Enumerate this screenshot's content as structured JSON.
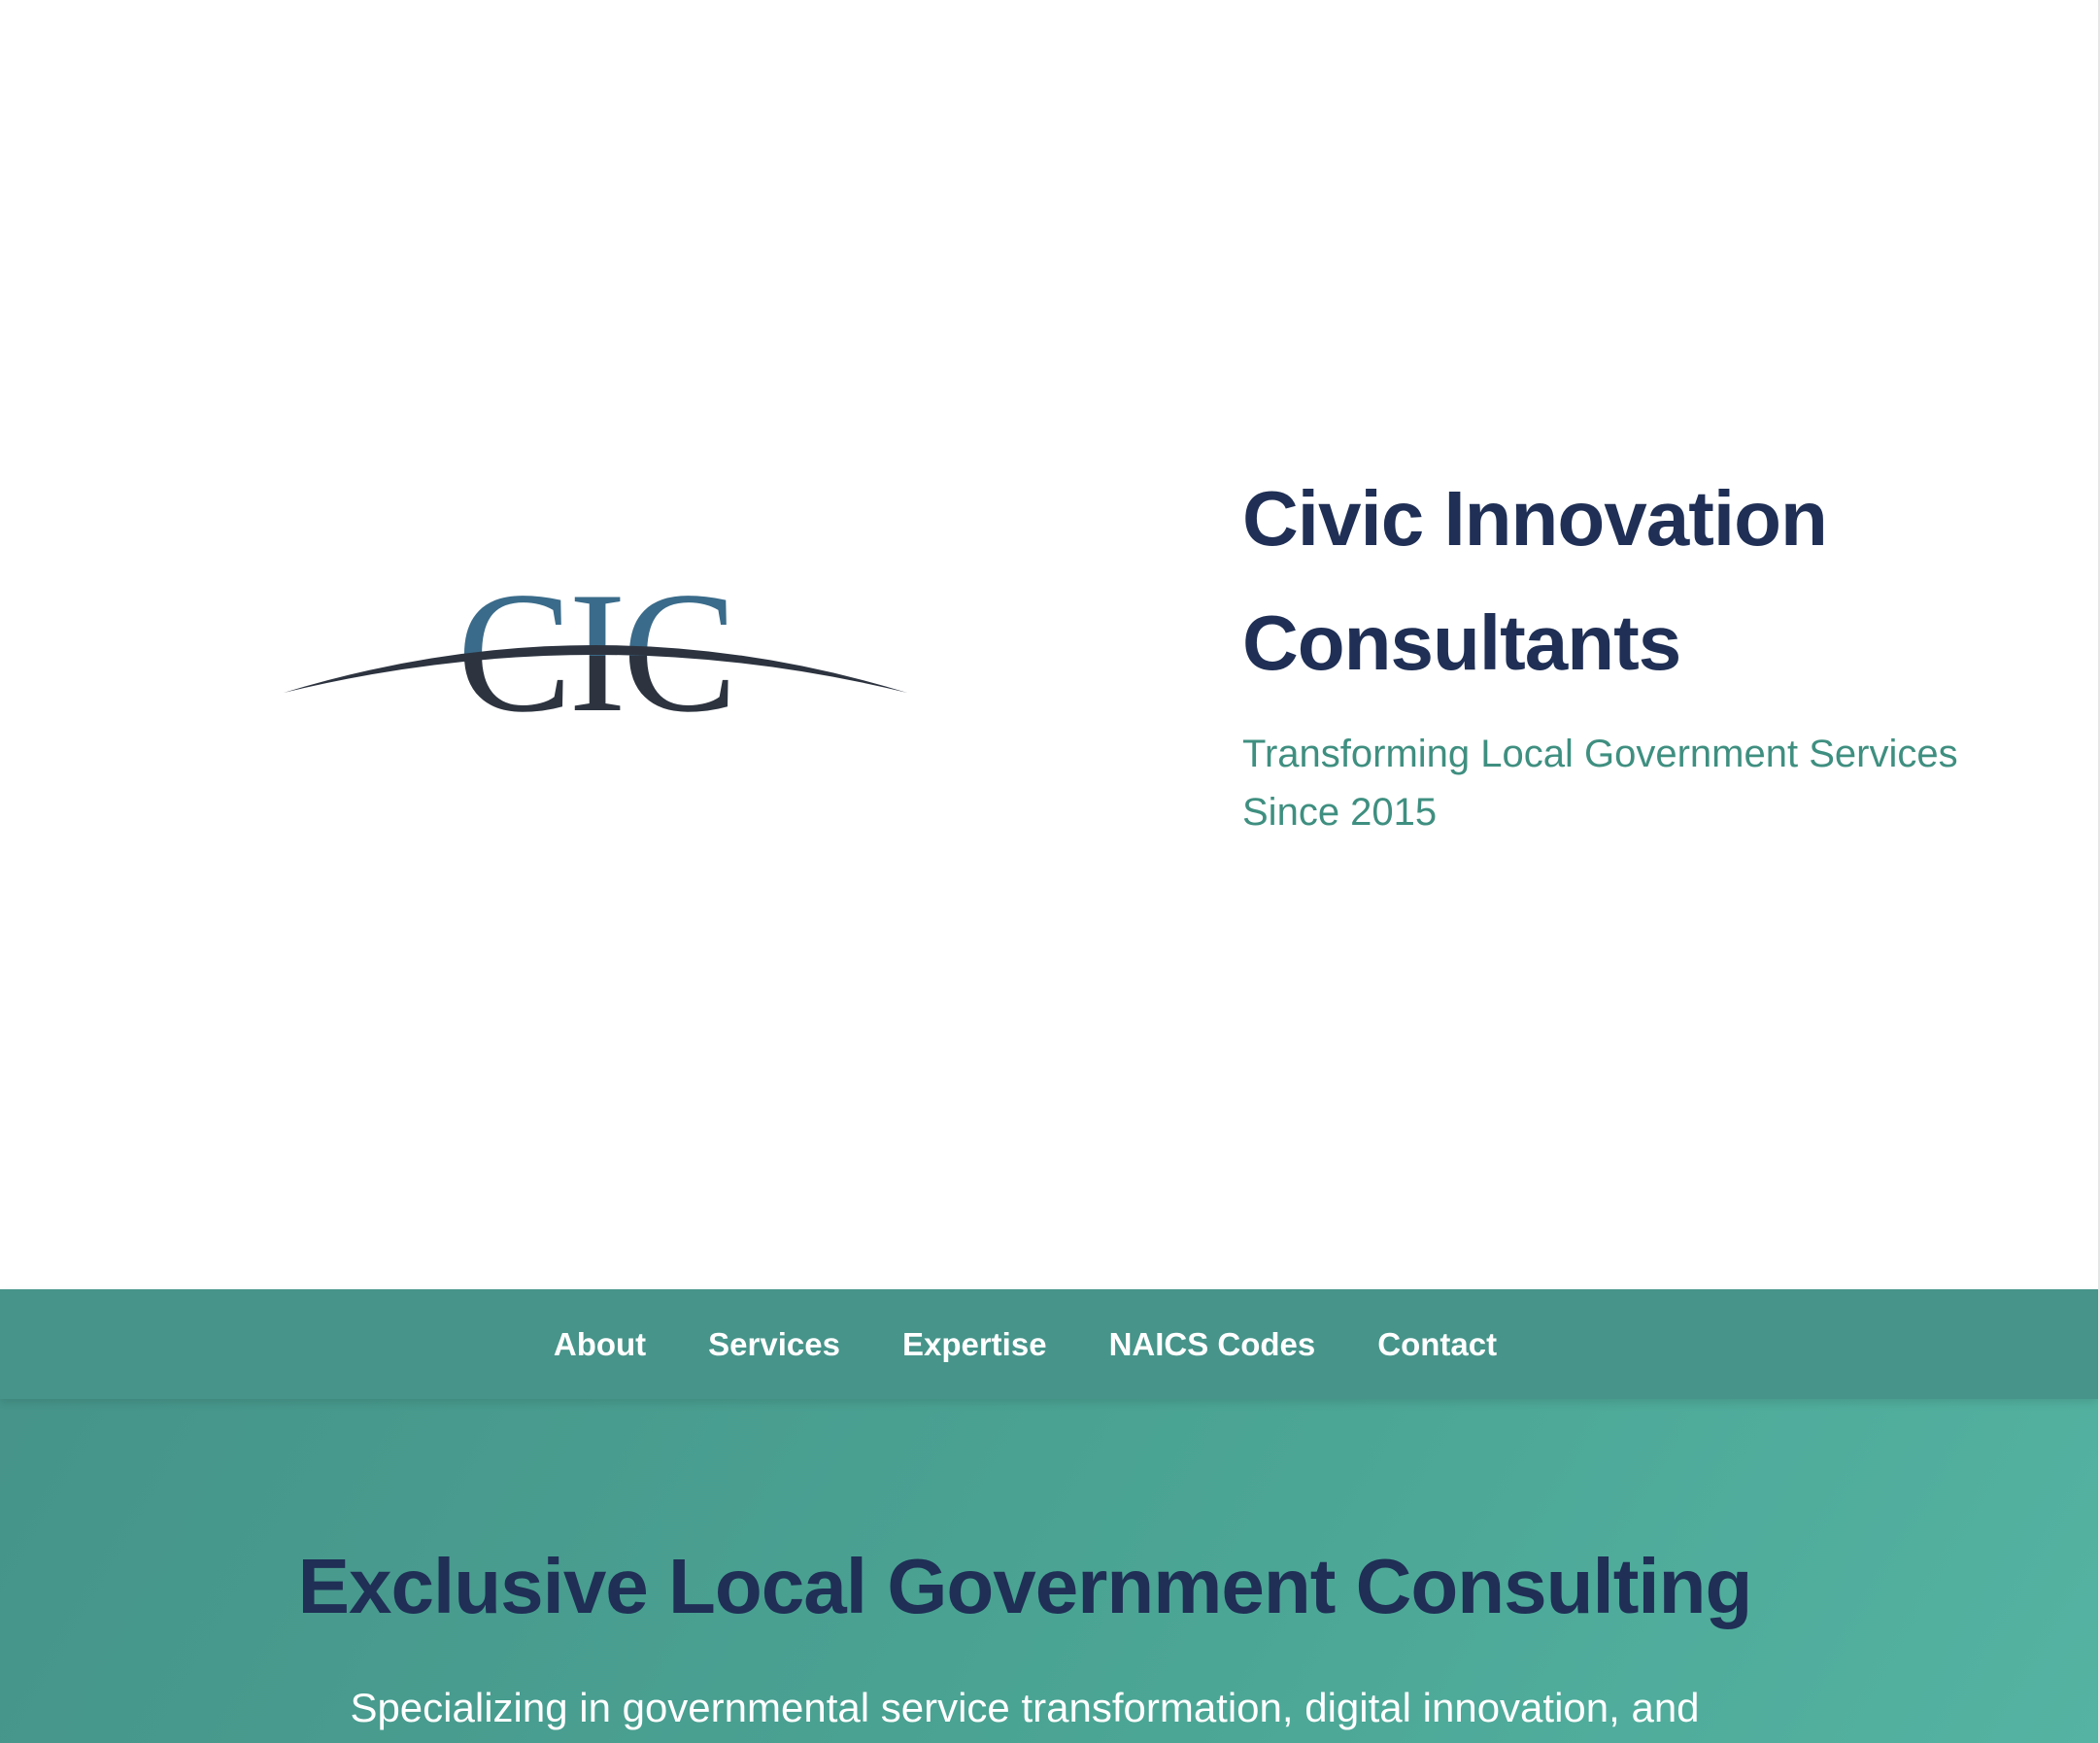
{
  "header": {
    "logo_text": "CIC",
    "title_line1": "Civic Innovation",
    "title_line2": "Consultants",
    "tagline": "Transforming Local Government Services Since 2015"
  },
  "nav": {
    "items": [
      {
        "label": "About"
      },
      {
        "label": "Services"
      },
      {
        "label": "Expertise"
      },
      {
        "label": "NAICS Codes"
      },
      {
        "label": "Contact"
      }
    ]
  },
  "hero": {
    "title": "Exclusive Local Government Consulting",
    "subtitle": "Specializing in governmental service transformation, digital innovation, and"
  },
  "colors": {
    "navy": "#1f2f55",
    "teal": "#46948a",
    "teal_light": "#54b3a2",
    "tagline": "#3f8f80",
    "logo_blue": "#3a6b8a",
    "logo_dark": "#2d3440"
  }
}
